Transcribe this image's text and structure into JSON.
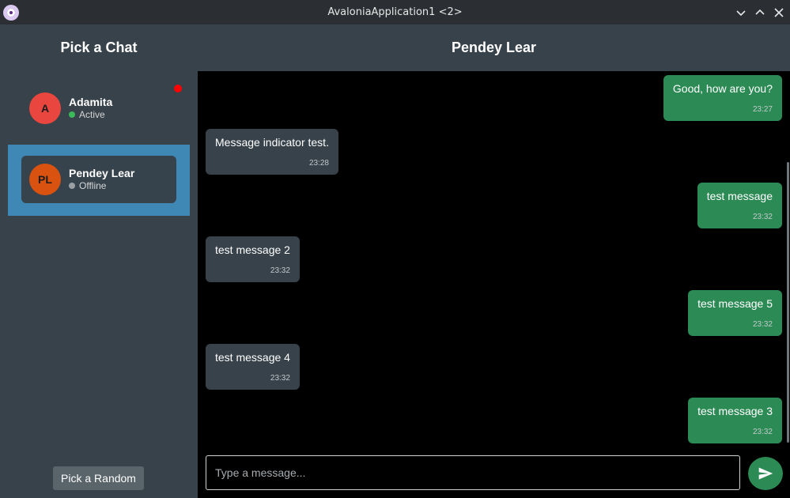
{
  "window": {
    "title": "AvaloniaApplication1 <2>"
  },
  "sidebar": {
    "title": "Pick a Chat",
    "chats": [
      {
        "initials": "A",
        "name": "Adamita",
        "status": "Active",
        "status_color": "#3cb95a",
        "avatar_color": "#e8463f",
        "unread": true,
        "selected": false
      },
      {
        "initials": "PL",
        "name": "Pendey Lear",
        "status": "Offline",
        "status_color": "#9aa0a4",
        "avatar_color": "#d9520f",
        "unread": false,
        "selected": true
      }
    ],
    "random_button": "Pick a Random"
  },
  "conversation": {
    "title": "Pendey Lear",
    "messages": [
      {
        "text": "Good, how are you?",
        "time": "23:27",
        "direction": "out"
      },
      {
        "text": "Message indicator test.",
        "time": "23:28",
        "direction": "in"
      },
      {
        "text": "test message",
        "time": "23:32",
        "direction": "out"
      },
      {
        "text": "test message 2",
        "time": "23:32",
        "direction": "in"
      },
      {
        "text": "test message 5",
        "time": "23:32",
        "direction": "out"
      },
      {
        "text": "test message 4",
        "time": "23:32",
        "direction": "in"
      },
      {
        "text": "test message 3",
        "time": "23:32",
        "direction": "out"
      }
    ]
  },
  "input": {
    "placeholder": "Type a message...",
    "value": ""
  },
  "colors": {
    "accent_selected": "#3f88b6",
    "outgoing_bubble": "#2c8b55",
    "incoming_bubble": "#37424a",
    "unread_indicator": "#ff0000"
  }
}
